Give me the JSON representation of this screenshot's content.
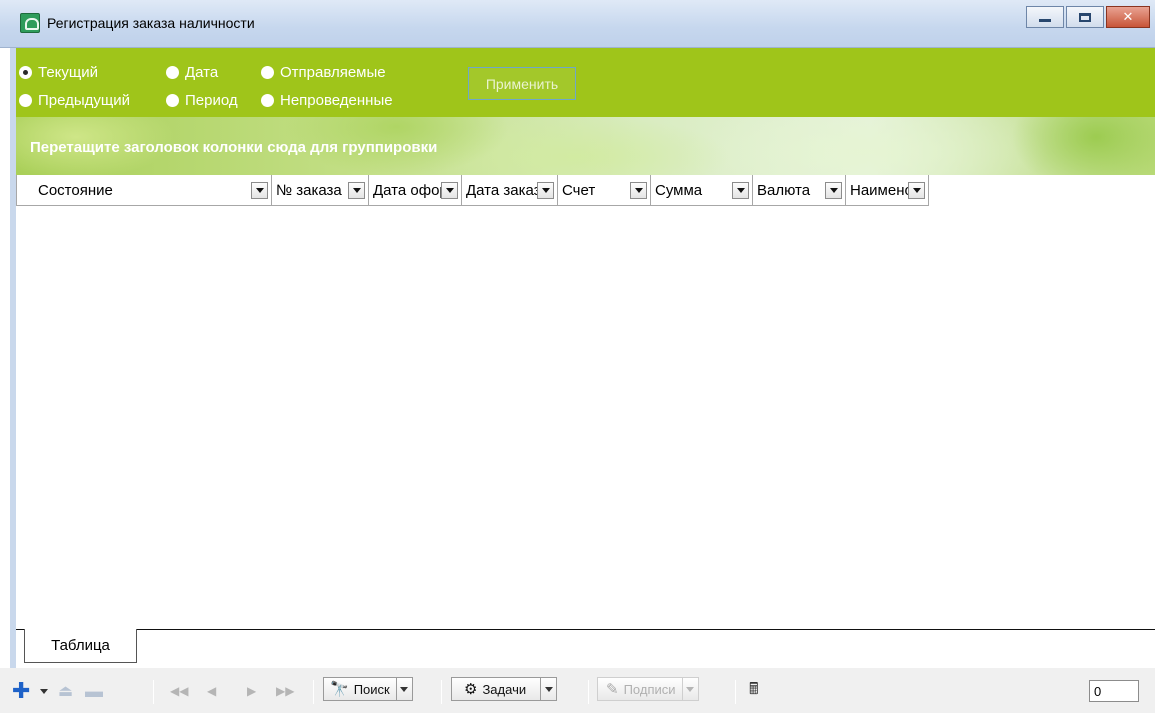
{
  "window": {
    "title": "Регистрация заказа наличности",
    "icon": "app-money-icon"
  },
  "filter": {
    "radios": [
      {
        "label": "Текущий",
        "checked": true
      },
      {
        "label": "Дата",
        "checked": false
      },
      {
        "label": "Отправляемые",
        "checked": false
      },
      {
        "label": "Предыдущий",
        "checked": false
      },
      {
        "label": "Период",
        "checked": false
      },
      {
        "label": "Непроведенные",
        "checked": false
      }
    ],
    "apply_label": "Применить"
  },
  "grid": {
    "group_hint": "Перетащите заголовок колонки сюда для группировки",
    "columns": [
      {
        "label": "Состояние"
      },
      {
        "label": "№ заказа"
      },
      {
        "label": "Дата оформления"
      },
      {
        "label": "Дата заказа"
      },
      {
        "label": "Счет"
      },
      {
        "label": "Сумма"
      },
      {
        "label": "Валюта"
      },
      {
        "label": "Наименование"
      }
    ]
  },
  "tabs": {
    "table_label": "Таблица"
  },
  "toolbar": {
    "search_label": "Поиск",
    "tasks_label": "Задачи",
    "signatures_label": "Подписи",
    "record_count": "0"
  },
  "colors": {
    "filter_bg": "#9fc51a",
    "accent_blue": "#1e62c8"
  }
}
